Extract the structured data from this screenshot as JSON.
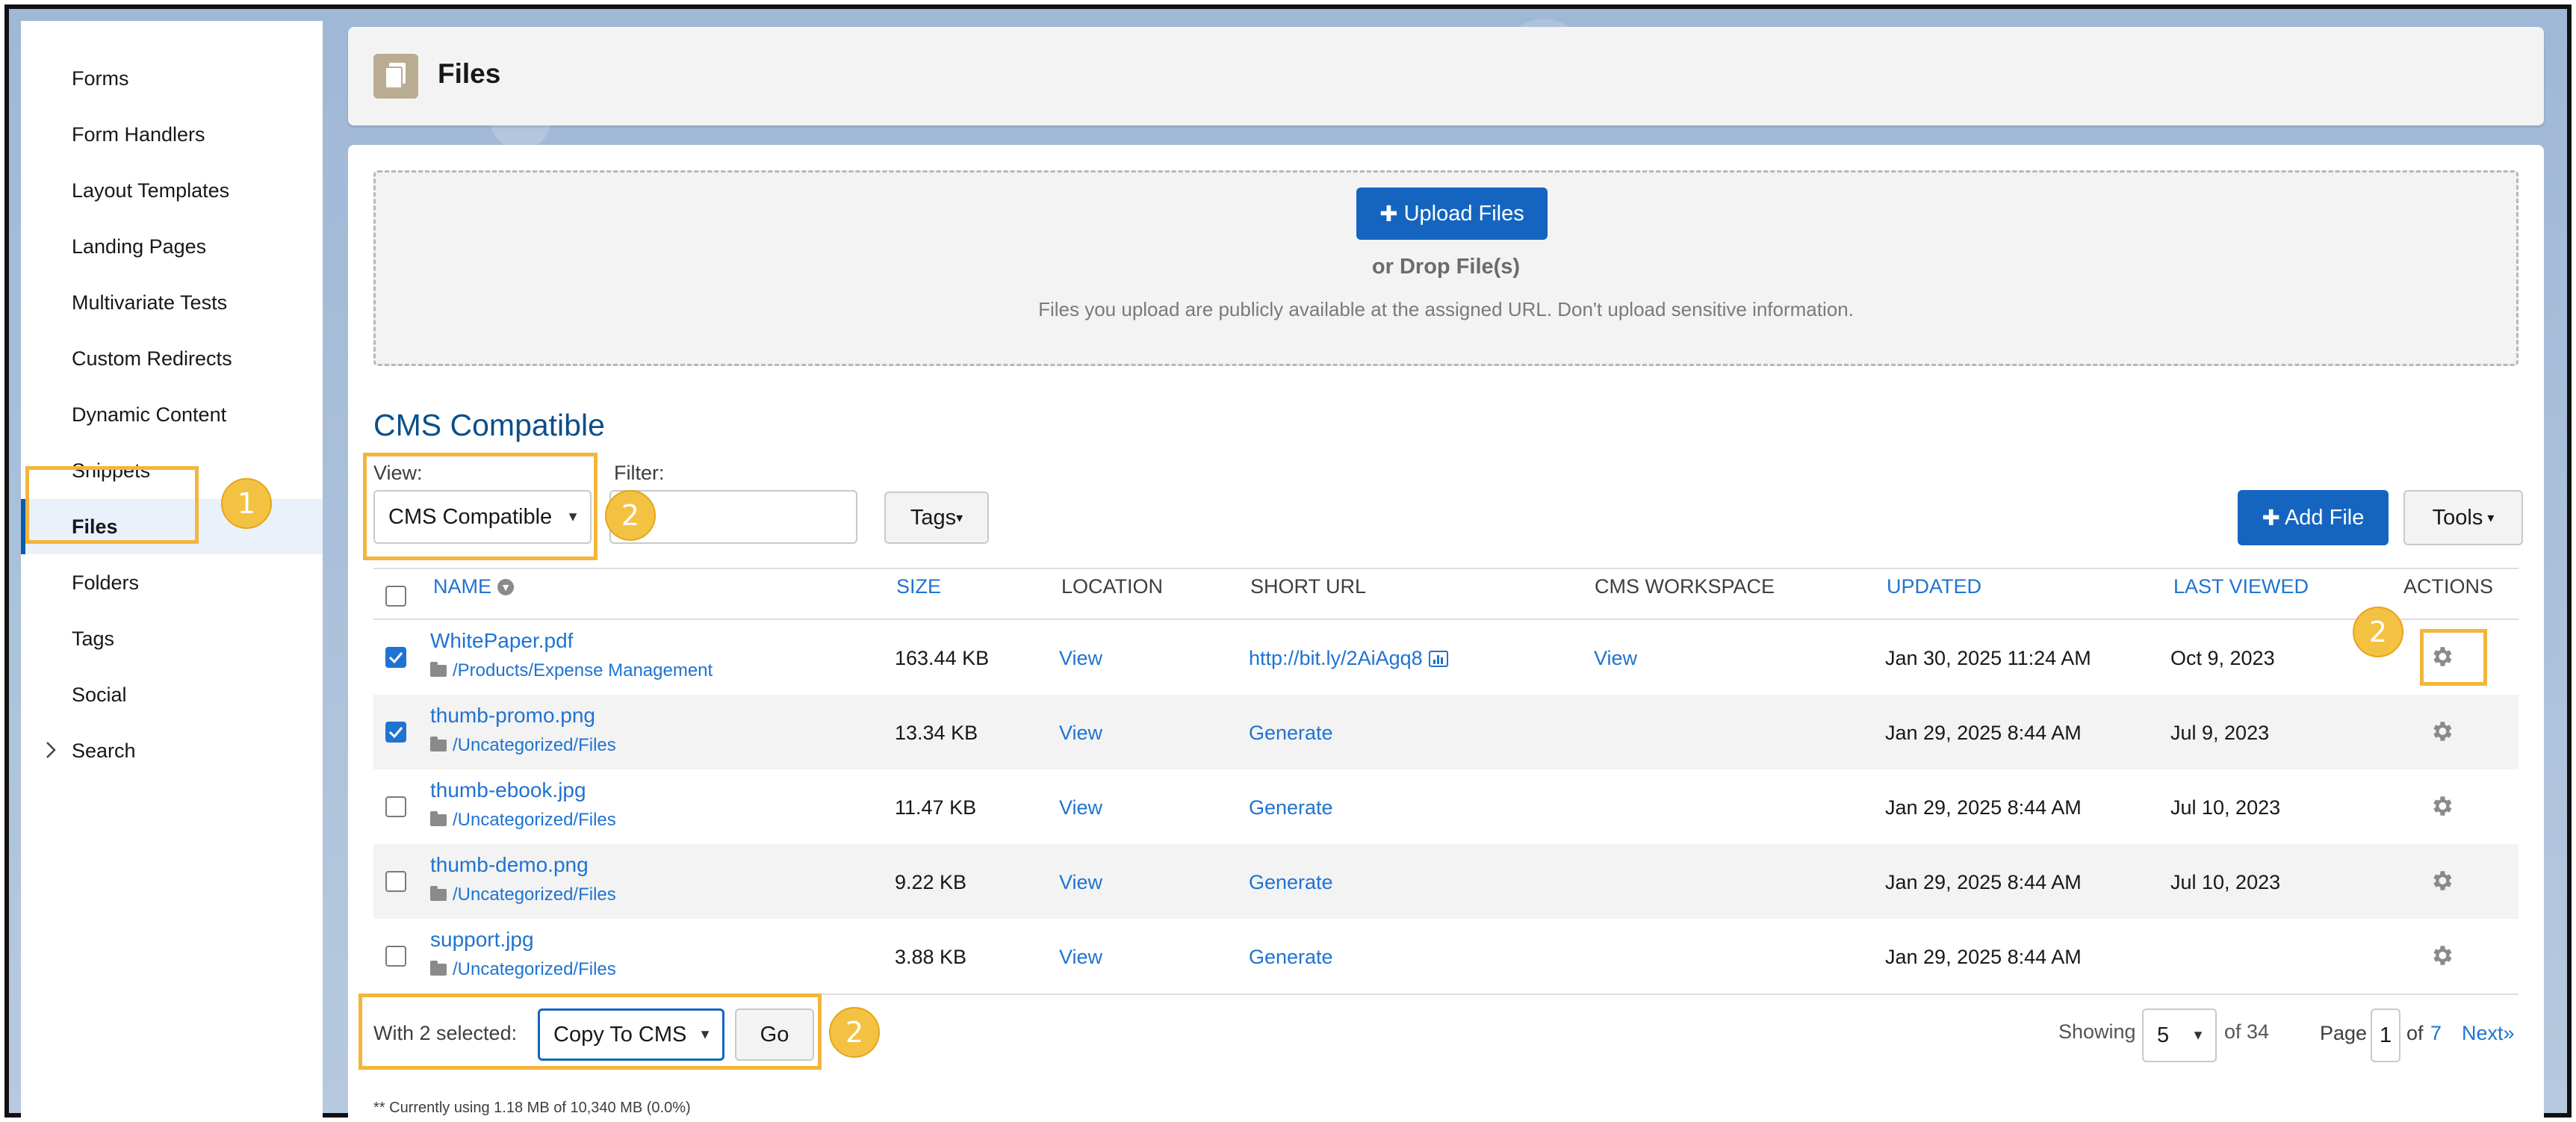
{
  "sidebar": {
    "items": [
      {
        "label": "Forms"
      },
      {
        "label": "Form Handlers"
      },
      {
        "label": "Layout Templates"
      },
      {
        "label": "Landing Pages"
      },
      {
        "label": "Multivariate Tests"
      },
      {
        "label": "Custom Redirects"
      },
      {
        "label": "Dynamic Content"
      },
      {
        "label": "Snippets"
      },
      {
        "label": "Files",
        "active": true
      },
      {
        "label": "Folders"
      },
      {
        "label": "Tags"
      },
      {
        "label": "Social"
      },
      {
        "label": "Search",
        "expandable": true
      }
    ]
  },
  "header": {
    "title": "Files",
    "icon": "document-icon"
  },
  "upload": {
    "button_label": "Upload Files",
    "drop_text": "or Drop File(s)",
    "note": "Files you upload are publicly available at the assigned URL. Don't upload sensitive information."
  },
  "section_title": "CMS Compatible",
  "filters": {
    "view_label": "View:",
    "view_value": "CMS Compatible",
    "filter_label": "Filter:",
    "filter_value": "",
    "tags_label": "Tags",
    "add_file_label": "Add File",
    "tools_label": "Tools"
  },
  "table": {
    "headers": {
      "name": "NAME",
      "size": "SIZE",
      "location": "LOCATION",
      "short_url": "SHORT URL",
      "cms_workspace": "CMS WORKSPACE",
      "updated": "UPDATED",
      "last_viewed": "LAST VIEWED",
      "actions": "ACTIONS"
    },
    "rows": [
      {
        "checked": true,
        "name": "WhitePaper.pdf",
        "path": "/Products/Expense Management",
        "size": "163.44 KB",
        "location": "View",
        "short_url": "http://bit.ly/2AiAgq8",
        "cms_workspace": "View",
        "updated": "Jan 30, 2025 11:24 AM",
        "last_viewed": "Oct 9, 2023"
      },
      {
        "checked": true,
        "name": "thumb-promo.png",
        "path": "/Uncategorized/Files",
        "size": "13.34 KB",
        "location": "View",
        "short_url": "Generate",
        "cms_workspace": "",
        "updated": "Jan 29, 2025 8:44 AM",
        "last_viewed": "Jul 9, 2023"
      },
      {
        "checked": false,
        "name": "thumb-ebook.jpg",
        "path": "/Uncategorized/Files",
        "size": "11.47 KB",
        "location": "View",
        "short_url": "Generate",
        "cms_workspace": "",
        "updated": "Jan 29, 2025 8:44 AM",
        "last_viewed": "Jul 10, 2023"
      },
      {
        "checked": false,
        "name": "thumb-demo.png",
        "path": "/Uncategorized/Files",
        "size": "9.22 KB",
        "location": "View",
        "short_url": "Generate",
        "cms_workspace": "",
        "updated": "Jan 29, 2025 8:44 AM",
        "last_viewed": "Jul 10, 2023"
      },
      {
        "checked": false,
        "name": "support.jpg",
        "path": "/Uncategorized/Files",
        "size": "3.88 KB",
        "location": "View",
        "short_url": "Generate",
        "cms_workspace": "",
        "updated": "Jan 29, 2025 8:44 AM",
        "last_viewed": ""
      }
    ]
  },
  "bulk": {
    "label": "With 2 selected:",
    "action_value": "Copy To CMS",
    "go_label": "Go"
  },
  "pagination": {
    "showing_label": "Showing",
    "per_page": "5",
    "of_total": "of 34",
    "page_label": "Page",
    "page_value": "1",
    "of_label": "of",
    "total_pages": "7",
    "next_label": "Next»"
  },
  "usage_note": "** Currently using 1.18 MB of 10,340 MB (0.0%)",
  "annotations": {
    "badge_1": "1",
    "badge_2a": "2",
    "badge_2b": "2",
    "badge_2c": "2"
  },
  "colors": {
    "accent": "#1565c0",
    "link": "#1f73d1",
    "highlight": "#f2b63c",
    "badge": "#f4c242"
  }
}
